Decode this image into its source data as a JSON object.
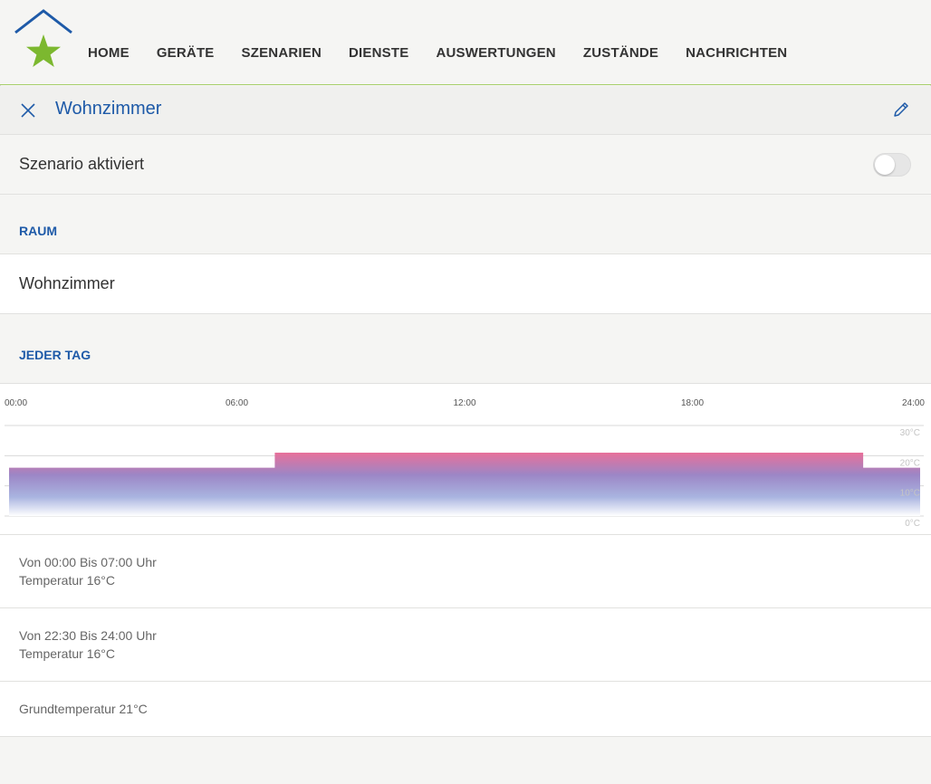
{
  "nav": {
    "items": [
      "HOME",
      "GERÄTE",
      "SZENARIEN",
      "DIENSTE",
      "AUSWERTUNGEN",
      "ZUSTÄNDE",
      "NACHRICHTEN"
    ]
  },
  "title": "Wohnzimmer",
  "toggle": {
    "label": "Szenario aktiviert",
    "enabled": false
  },
  "room": {
    "heading": "RAUM",
    "value": "Wohnzimmer"
  },
  "schedule": {
    "heading": "JEDER TAG",
    "entries": [
      {
        "time": "Von 00:00 Bis 07:00 Uhr",
        "temp": "Temperatur 16°C"
      },
      {
        "time": "Von 22:30 Bis 24:00 Uhr",
        "temp": "Temperatur 16°C"
      }
    ],
    "base": "Grundtemperatur 21°C"
  },
  "colors": {
    "accent": "#1e5aa8",
    "brand_green": "#7cb82f",
    "divider_green": "#a7cf6b",
    "bar_pink": "#e8709a",
    "bar_blue": "#7b8fd1"
  },
  "chart_data": {
    "type": "area",
    "x_tick_labels": [
      "00:00",
      "06:00",
      "12:00",
      "18:00",
      "24:00"
    ],
    "y_tick_labels": [
      "30°C",
      "20°C",
      "10°C",
      "0°C"
    ],
    "xlim": [
      0,
      24
    ],
    "ylim": [
      0,
      30
    ],
    "series": [
      {
        "x": [
          0,
          7,
          7,
          22.5,
          22.5,
          24
        ],
        "y": [
          16,
          16,
          21,
          21,
          16,
          16
        ]
      }
    ],
    "grid": true
  }
}
